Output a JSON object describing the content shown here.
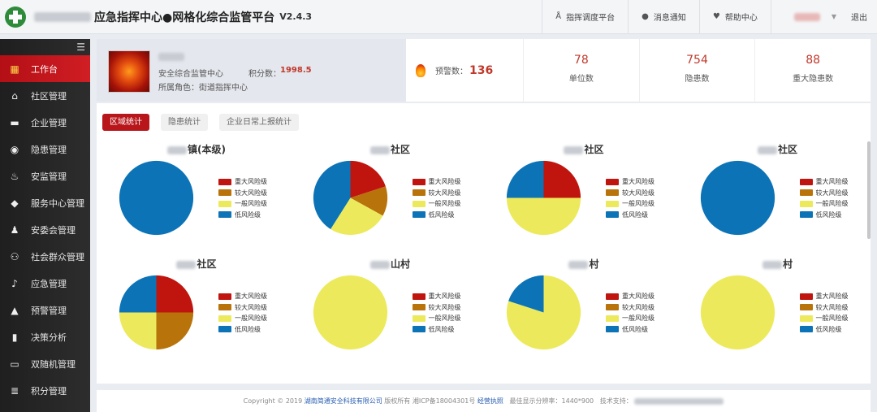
{
  "header": {
    "title": "应急指挥中心●网格化综合监管平台",
    "version": "V2.4.3",
    "nav": [
      {
        "label": "指挥调度平台",
        "icon": "dispatch-icon"
      },
      {
        "label": "消息通知",
        "icon": "message-icon"
      },
      {
        "label": "帮助中心",
        "icon": "heart-icon"
      }
    ],
    "logout": "退出"
  },
  "sidebar": {
    "items": [
      {
        "label": "工作台",
        "icon": "workspace-icon",
        "active": true
      },
      {
        "label": "社区管理",
        "icon": "home-icon"
      },
      {
        "label": "企业管理",
        "icon": "briefcase-icon"
      },
      {
        "label": "隐患管理",
        "icon": "hazard-icon"
      },
      {
        "label": "安监管理",
        "icon": "fire-icon"
      },
      {
        "label": "服务中心管理",
        "icon": "cube-icon"
      },
      {
        "label": "安委会管理",
        "icon": "person-icon"
      },
      {
        "label": "社会群众管理",
        "icon": "group-icon"
      },
      {
        "label": "应急管理",
        "icon": "bell-icon"
      },
      {
        "label": "预警管理",
        "icon": "warning-icon"
      },
      {
        "label": "决策分析",
        "icon": "bar-chart-icon"
      },
      {
        "label": "双随机管理",
        "icon": "computer-icon"
      },
      {
        "label": "积分管理",
        "icon": "database-icon"
      }
    ]
  },
  "profile": {
    "org": "安全综合监管中心",
    "points_label": "积分数：",
    "points": "1998.5",
    "role_label": "所属角色：",
    "role": "街道指挥中心"
  },
  "stats": {
    "warn_label": "预警数：",
    "warn_value": "136",
    "cells": [
      {
        "value": "78",
        "label": "单位数"
      },
      {
        "value": "754",
        "label": "隐患数"
      },
      {
        "value": "88",
        "label": "重大隐患数"
      }
    ]
  },
  "tabs": [
    {
      "label": "区域统计",
      "active": true
    },
    {
      "label": "隐患统计",
      "active": false
    },
    {
      "label": "企业日常上报统计",
      "active": false
    }
  ],
  "legend_labels": [
    "重大风险级",
    "较大风险级",
    "一般风险级",
    "低风险级"
  ],
  "colors": {
    "major": "#c0150f",
    "large": "#b8730a",
    "general": "#ecea5c",
    "low": "#0b73b6",
    "accent": "#b8161b"
  },
  "chart_data": [
    {
      "type": "pie",
      "title": "镇(本级)",
      "categories": [
        "重大风险级",
        "较大风险级",
        "一般风险级",
        "低风险级"
      ],
      "values": [
        0,
        0,
        0,
        100
      ]
    },
    {
      "type": "pie",
      "title": "社区",
      "categories": [
        "重大风险级",
        "较大风险级",
        "一般风险级",
        "低风险级"
      ],
      "values": [
        20,
        13,
        26,
        41
      ]
    },
    {
      "type": "pie",
      "title": "社区",
      "categories": [
        "重大风险级",
        "较大风险级",
        "一般风险级",
        "低风险级"
      ],
      "values": [
        25,
        0,
        50,
        25
      ]
    },
    {
      "type": "pie",
      "title": "社区",
      "categories": [
        "重大风险级",
        "较大风险级",
        "一般风险级",
        "低风险级"
      ],
      "values": [
        0,
        0,
        0,
        100
      ]
    },
    {
      "type": "pie",
      "title": "社区",
      "categories": [
        "重大风险级",
        "较大风险级",
        "一般风险级",
        "低风险级"
      ],
      "values": [
        25,
        25,
        25,
        25
      ]
    },
    {
      "type": "pie",
      "title": "山村",
      "categories": [
        "重大风险级",
        "较大风险级",
        "一般风险级",
        "低风险级"
      ],
      "values": [
        0,
        0,
        100,
        0
      ]
    },
    {
      "type": "pie",
      "title": "村",
      "categories": [
        "重大风险级",
        "较大风险级",
        "一般风险级",
        "低风险级"
      ],
      "values": [
        0,
        0,
        80,
        20
      ]
    },
    {
      "type": "pie",
      "title": "村",
      "categories": [
        "重大风险级",
        "较大风险级",
        "一般风险级",
        "低风险级"
      ],
      "values": [
        0,
        0,
        100,
        0
      ]
    }
  ],
  "footer": {
    "copyright": "Copyright © 2019",
    "company": "湖南简通安全科技有限公司",
    "rights": "版权所有 湘ICP备18004301号",
    "license": "经营执照",
    "resolution": "最佳显示分辨率：1440*900",
    "support": "技术支持："
  }
}
